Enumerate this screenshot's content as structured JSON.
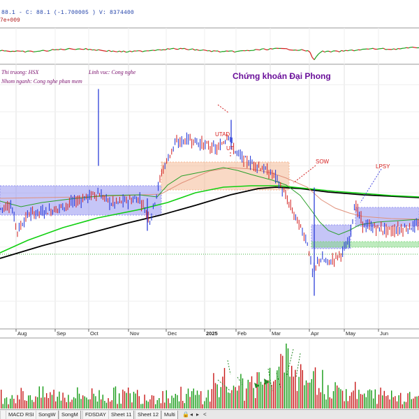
{
  "header": {
    "quote_line": "88.1 - C: 88.1 (-1.700005 ) V: 8374400",
    "sub_line": "7e+009"
  },
  "info": {
    "market": "Thi truong: HSX",
    "field": "Linh vuc: Cong nghe",
    "group": "Nhom nganh: Cong nghe phan mem"
  },
  "chart_data": {
    "type": "candlestick",
    "title": "Chứng khoán Đại Phong",
    "annotations": [
      "UTAD",
      "UT",
      "SOW",
      "LPSY"
    ],
    "x_ticks": [
      "Aug",
      "Sep",
      "Oct",
      "Nov",
      "Dec",
      "2025",
      "Feb",
      "Mar",
      "Apr",
      "May",
      "Jun"
    ],
    "x_range": [
      "2024-07",
      "2025-06"
    ],
    "ohlc_monthly_close": [
      {
        "month": "2024-07",
        "close": 88
      },
      {
        "month": "2024-08",
        "close": 91
      },
      {
        "month": "2024-09",
        "close": 93
      },
      {
        "month": "2024-10",
        "close": 94
      },
      {
        "month": "2024-11",
        "close": 92
      },
      {
        "month": "2024-12",
        "close": 104
      },
      {
        "month": "2025-01",
        "close": 103
      },
      {
        "month": "2025-02",
        "close": 99
      },
      {
        "month": "2025-03",
        "close": 92
      },
      {
        "month": "2025-04",
        "close": 79
      },
      {
        "month": "2025-05",
        "close": 88
      },
      {
        "month": "2025-06",
        "close": 88
      }
    ],
    "series": [
      {
        "name": "",
        "color": "#000000",
        "kind": "MA long"
      },
      {
        "name": "",
        "color": "#10d010",
        "kind": "MA medium"
      },
      {
        "name": "",
        "color": "#2aa02a",
        "kind": "MA short"
      },
      {
        "name": "",
        "color": "#e0907a",
        "kind": "MA short 2"
      }
    ],
    "grid": true,
    "volume": {
      "colors": {
        "up": "#139a13",
        "down": "#c81818"
      }
    },
    "zones": [
      {
        "kind": "range",
        "color": "#8c8cf0",
        "from": "2024-07",
        "to": "2024-11"
      },
      {
        "kind": "distribution",
        "color": "#f4b48c",
        "from": "2024-12",
        "to": "2025-02"
      },
      {
        "kind": "range",
        "color": "#8c8cf0",
        "from": "2025-04",
        "to": "2025-05"
      },
      {
        "kind": "range",
        "color": "#8c8cf0",
        "from": "2025-05",
        "to": "2025-06"
      },
      {
        "kind": "support",
        "color": "#7ed87e",
        "from": "2025-05",
        "to": "2025-06"
      }
    ]
  },
  "tabs": [
    "MACD RSI",
    "SongW",
    "SongM",
    "FDSDAY",
    "Sheet 11",
    "Sheet 12",
    "Multi"
  ],
  "tab_icons": [
    "lock-icon",
    "arrow-left-icon",
    "arrow-right-icon",
    "arrow-left-small-icon"
  ]
}
